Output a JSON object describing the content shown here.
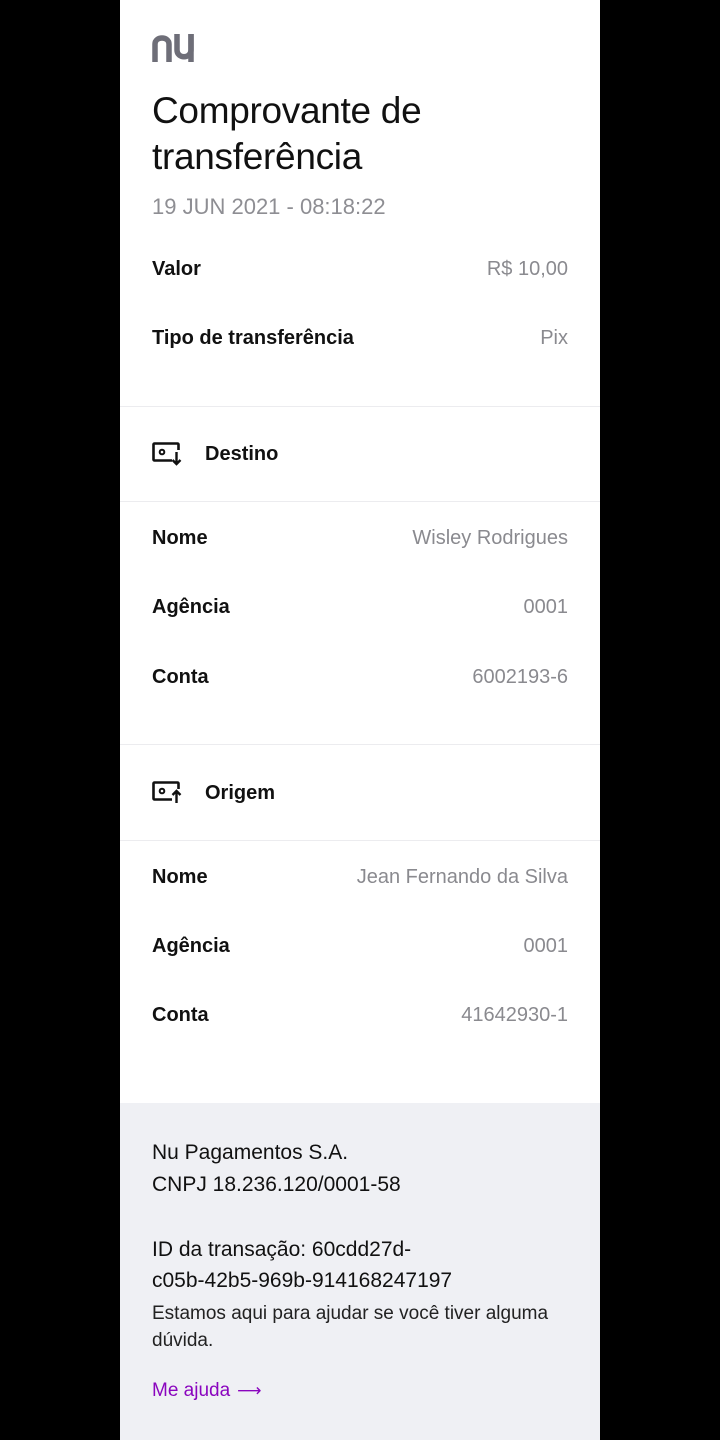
{
  "brand": {
    "logo_text": "nu",
    "logo_color": "#6e6e78"
  },
  "header": {
    "title_line1": "Comprovante de",
    "title_line2": "transferência",
    "date": "19 JUN 2021 - 08:18:22"
  },
  "summary": [
    {
      "label": "Valor",
      "value": "R$ 10,00"
    },
    {
      "label": "Tipo de transferência",
      "value": "Pix"
    }
  ],
  "destino": {
    "title": "Destino",
    "icon": "bank-card-in-icon",
    "rows": [
      {
        "label": "Nome",
        "value": "Wisley Rodrigues"
      },
      {
        "label": "Agência",
        "value": "0001"
      },
      {
        "label": "Conta",
        "value": "6002193-6"
      }
    ]
  },
  "origem": {
    "title": "Origem",
    "icon": "bank-card-out-icon",
    "rows": [
      {
        "label": "Nome",
        "value": "Jean Fernando da Silva"
      },
      {
        "label": "Agência",
        "value": "0001"
      },
      {
        "label": "Conta",
        "value": "41642930-1"
      }
    ]
  },
  "footer": {
    "company": "Nu Pagamentos S.A.",
    "cnpj": "CNPJ 18.236.120/0001-58",
    "transaction_line1": "ID da transação: 60cdd27d-",
    "transaction_line2": "c05b-42b5-969b-914168247197",
    "help_text": "Estamos aqui para ajudar se você tiver alguma dúvida.",
    "help_link": "Me ajuda",
    "link_color": "#8a05be",
    "background": "#eff0f4"
  }
}
